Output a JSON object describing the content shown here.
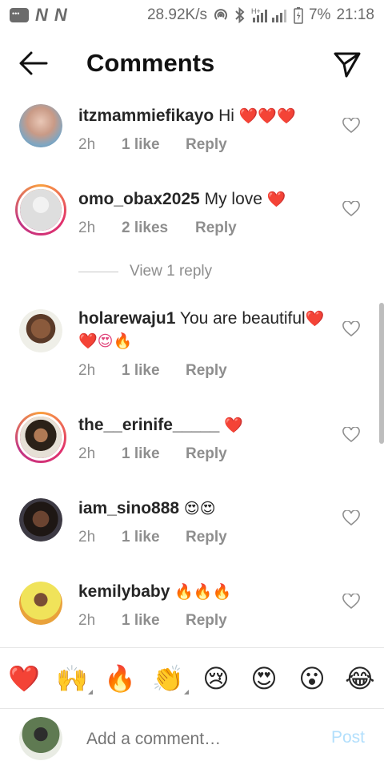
{
  "status": {
    "speed": "28.92K/s",
    "battery": "7%",
    "time": "21:18",
    "network": "H+"
  },
  "header": {
    "title": "Comments"
  },
  "comments": [
    {
      "user": "itzmammiefikayo",
      "text": "Hi",
      "emoji": "❤️❤️❤️",
      "time": "2h",
      "likes": "1 like",
      "reply": "Reply",
      "ring": false
    },
    {
      "user": "omo_obax2025",
      "text": "My love",
      "emoji": "❤️",
      "time": "2h",
      "likes": "2 likes",
      "reply": "Reply",
      "ring": true
    },
    {
      "user": "holarewaju1",
      "text": "You are beautiful",
      "emoji": "❤️❤️😍🔥",
      "time": "2h",
      "likes": "1 like",
      "reply": "Reply",
      "ring": false
    },
    {
      "user": "the__erinife_____",
      "text": "",
      "emoji": "❤️",
      "time": "2h",
      "likes": "1 like",
      "reply": "Reply",
      "ring": true
    },
    {
      "user": "iam_sino888",
      "text": "",
      "emoji": "😍😍",
      "time": "2h",
      "likes": "1 like",
      "reply": "Reply",
      "ring": false
    },
    {
      "user": "kemilybaby",
      "text": "",
      "emoji": "🔥🔥🔥",
      "time": "2h",
      "likes": "1 like",
      "reply": "Reply",
      "ring": false
    }
  ],
  "view_replies": "View 1 reply",
  "emoji_bar": [
    "❤️",
    "🙌",
    "🔥",
    "👏",
    "😢",
    "😍",
    "😮",
    "😂"
  ],
  "composer": {
    "placeholder": "Add a comment…",
    "post_label": "Post"
  },
  "colors": {
    "heart": "#e0457b",
    "post_disabled": "#b2dffc",
    "meta": "#8e8e8e"
  }
}
